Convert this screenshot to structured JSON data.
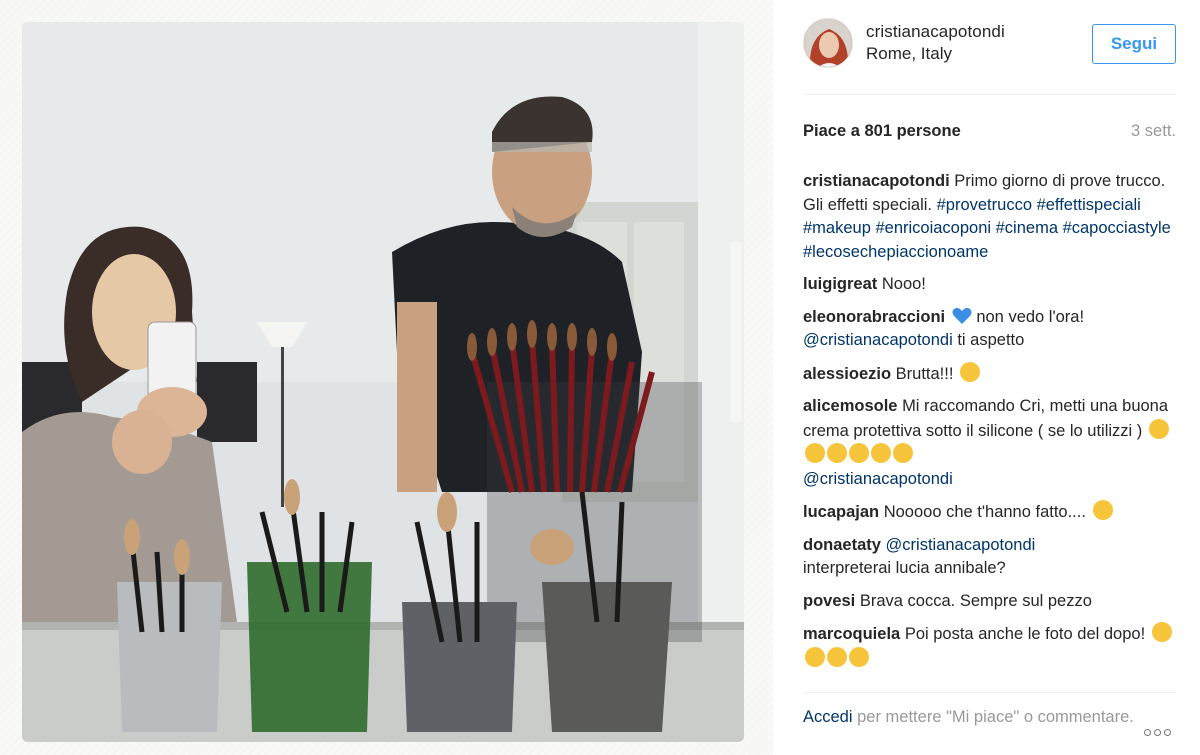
{
  "post": {
    "photo_alt": "",
    "icons": {
      "photo": "photo-image",
      "avatar": "avatar-image",
      "more": "more-options-icon"
    }
  },
  "header": {
    "username": "cristianacapotondi",
    "location": "Rome, Italy",
    "follow_label": "Segui",
    "accent_color": "#3897f0"
  },
  "stats": {
    "likes": "Piace a 801 persone",
    "time": "3 sett."
  },
  "caption": {
    "author": "cristianacapotondi",
    "text": "Primo giorno di prove trucco. Gli effetti speciali.",
    "hashtags": "#provetrucco #effettispeciali #makeup #enricoiacoponi #cinema #capocciastyle #lecosechepiaccionoame"
  },
  "comments": [
    {
      "author": "luigigreat",
      "text": "Nooo!"
    },
    {
      "author": "eleonorabraccioni",
      "text": "non vedo l'ora!",
      "mention": "@cristianacapotondi",
      "text2": "ti aspetto",
      "emoji": "blue-heart"
    },
    {
      "author": "alessioezio",
      "text": "Brutta!!!",
      "emoji": "winking-tongue-face"
    },
    {
      "author": "alicemosole",
      "text": "Mi raccomando Cri, metti una buona crema protettiva sotto il silicone ( se lo utilizzi )",
      "emoji": "grimacing-face, face-throwing-kiss x4",
      "mention": "@cristianacapotondi"
    },
    {
      "author": "lucapajan",
      "text": "Nooooo che t'hanno fatto....",
      "emoji": "fearful-face"
    },
    {
      "author": "donaetaty",
      "mention": "@cristianacapotondi",
      "text": "interpreterai lucia annibale?"
    },
    {
      "author": "povesi",
      "text": "Brava cocca. Sempre sul pezzo"
    },
    {
      "author": "marcoquiela",
      "text": "Poi posta anche le foto del dopo!",
      "emoji": "face-with-tears-of-joy x4"
    }
  ],
  "footer": {
    "login_link": "Accedi",
    "login_text": "per mettere \"Mi piace\" o commentare."
  }
}
